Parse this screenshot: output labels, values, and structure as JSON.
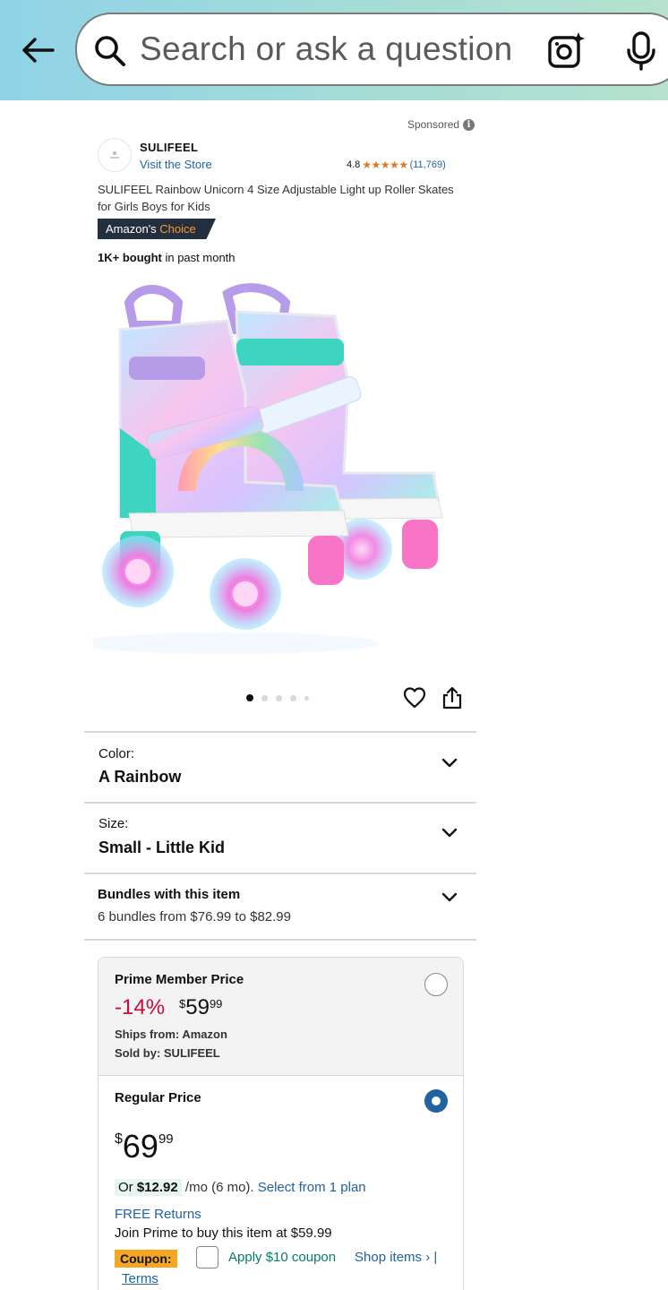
{
  "search": {
    "placeholder": "Search or ask a question",
    "icons": {
      "back": "back-arrow-icon",
      "search": "search-icon",
      "lens": "camera-lens-icon",
      "mic": "microphone-icon"
    }
  },
  "product": {
    "sponsored_label": "Sponsored",
    "brand": "SULIFEEL",
    "visit_store": "Visit the Store",
    "rating": "4.8",
    "stars": "★★★★★",
    "rating_count": "(11,769)",
    "title": "SULIFEEL Rainbow Unicorn 4 Size Adjustable Light up Roller Skates for Girls Boys for Kids",
    "badge": {
      "prefix": "Amazon's ",
      "highlight": "Choice"
    },
    "bought": {
      "bold": "1K+ bought",
      "rest": " in past month"
    },
    "image_alt": "Rainbow roller skates with light-up wheels",
    "image_count": 5,
    "active_image": 1
  },
  "options": {
    "color": {
      "label": "Color:",
      "value": "A Rainbow"
    },
    "size": {
      "label": "Size:",
      "value": "Small - Little Kid"
    },
    "bundles": {
      "title": "Bundles with this item",
      "subtitle": "6 bundles from $76.99 to $82.99"
    }
  },
  "pricing": {
    "prime": {
      "title": "Prime Member Price",
      "discount": "-14%",
      "currency": "$",
      "whole": "59",
      "cents": "99",
      "ships_from": "Ships from: Amazon",
      "sold_by": "Sold by: SULIFEEL",
      "selected": false
    },
    "regular": {
      "title": "Regular Price",
      "currency": "$",
      "whole": "69",
      "cents": "99",
      "selected": true,
      "installment_prefix": "Or ",
      "installment_amount": "$12.92",
      "installment_rest": " /mo (6 mo). ",
      "installment_link": "Select from 1 plan",
      "free_returns": "FREE Returns",
      "join_prime": "Join Prime to buy this item at $59.99",
      "coupon_label": "Coupon:",
      "coupon_apply": "Apply $10 coupon",
      "coupon_shop": "Shop items › |",
      "terms": "Terms"
    }
  },
  "colors": {
    "link": "#2162a1",
    "discount": "#cc0c39",
    "star": "#de7921",
    "badge_bg": "#232f3e",
    "badge_accent": "#f69931",
    "coupon_bg": "#f5a623"
  }
}
